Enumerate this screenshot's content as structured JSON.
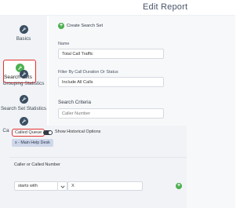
{
  "header": {
    "title": "Edit Report"
  },
  "sidebar": {
    "items": [
      {
        "label": "Basics",
        "icon": "wrench-icon",
        "active": false
      },
      {
        "label": "Search Sets",
        "icon": "wrench-icon",
        "active": true
      },
      {
        "label": "Grouping Statistics",
        "icon": "wrench-icon",
        "active": false
      },
      {
        "label": "Search Set Statistics",
        "icon": "wrench-icon",
        "active": false
      },
      {
        "label": "Call History Details",
        "icon": "wrench-icon",
        "active": false
      }
    ]
  },
  "main": {
    "create_search_set_label": "Create Search Set",
    "name_label": "Name",
    "name_value": "Total Call Traffic",
    "filter_label": "Filter By Call Duration Or Status",
    "filter_value": "Include All Calls",
    "search_criteria_title": "Search Criteria",
    "search_criteria_placeholder": "Caller Number",
    "called_queue_label": "Called Queue",
    "show_historical_label": "Show Historical Options",
    "show_historical_on": true,
    "queue_tag": "x - Main Help Desk",
    "caller_or_called_label": "Caller or Called Number",
    "match_select_value": "starts with",
    "match_value": "X"
  },
  "colors": {
    "accent_green": "#4caf50",
    "highlight_red": "#e03030",
    "icon_dark": "#3b4f63",
    "tag_blue": "#cfd8ea"
  }
}
